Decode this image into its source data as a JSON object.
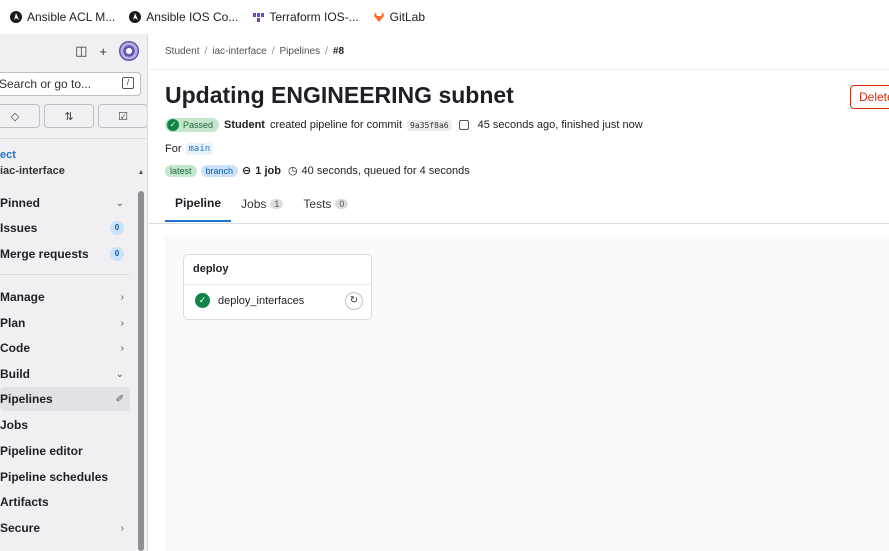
{
  "bookmarks": [
    {
      "label": "Ansible ACL M...",
      "icon": "ansible-icon"
    },
    {
      "label": "Ansible IOS Co...",
      "icon": "ansible-icon"
    },
    {
      "label": "Terraform IOS-...",
      "icon": "terraform-icon"
    },
    {
      "label": "GitLab",
      "icon": "gitlab-icon"
    }
  ],
  "sidebar": {
    "search_placeholder": "Search or go to...",
    "section_label": "ect",
    "project_name": "iac-interface",
    "items": [
      {
        "label": "Pinned",
        "indicator": "⌄"
      },
      {
        "label": "Issues",
        "badge": "0"
      },
      {
        "label": "Merge requests",
        "badge": "0"
      },
      {
        "label": "Manage",
        "indicator": "›"
      },
      {
        "label": "Plan",
        "indicator": "›"
      },
      {
        "label": "Code",
        "indicator": "›"
      },
      {
        "label": "Build",
        "indicator": "⌄"
      },
      {
        "label": "Pipelines",
        "indicator": "✐"
      },
      {
        "label": "Jobs"
      },
      {
        "label": "Pipeline editor"
      },
      {
        "label": "Pipeline schedules"
      },
      {
        "label": "Artifacts"
      },
      {
        "label": "Secure",
        "indicator": "›"
      }
    ]
  },
  "breadcrumb": {
    "items": [
      "Student",
      "iac-interface",
      "Pipelines"
    ],
    "current": "#8",
    "separator": "/"
  },
  "pipeline": {
    "title": "Updating ENGINEERING subnet",
    "delete_label": "Delete",
    "status": "Passed",
    "author": "Student",
    "created_text": "created pipeline for commit",
    "commit": "9a35f8a6",
    "timing": "45 seconds ago, finished just now",
    "for_label": "For",
    "branch": "main",
    "tag_latest": "latest",
    "tag_branch": "branch",
    "jobs_count": "1 job",
    "duration": "40 seconds, queued for 4 seconds"
  },
  "tabs": [
    {
      "label": "Pipeline"
    },
    {
      "label": "Jobs",
      "count": "1"
    },
    {
      "label": "Tests",
      "count": "0"
    }
  ],
  "stage": {
    "name": "deploy",
    "job": "deploy_interfaces"
  },
  "colors": {
    "accent": "#1f75cb",
    "success": "#108548",
    "danger": "#dd2b0e"
  }
}
